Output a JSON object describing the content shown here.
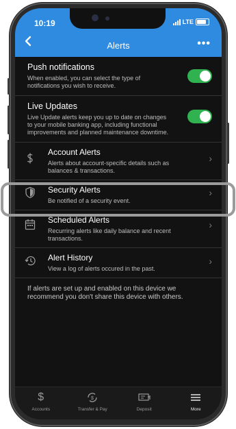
{
  "status": {
    "time": "10:19",
    "network": "LTE"
  },
  "nav": {
    "title": "Alerts",
    "back_icon": "chevron-left-icon",
    "more_label": "•••"
  },
  "toggles": [
    {
      "title": "Push notifications",
      "desc": "When enabled, you can select the type of notifications you wish to receive.",
      "on": true
    },
    {
      "title": "Live Updates",
      "desc": "Live Update alerts keep you up to date on changes to your mobile banking app, including functional improvements and planned maintenance downtime.",
      "on": true
    }
  ],
  "items": [
    {
      "title": "Account Alerts",
      "desc": "Alerts about account-specific details such as balances & transactions.",
      "icon": "dollar-icon"
    },
    {
      "title": "Security Alerts",
      "desc": "Be notified of a security event.",
      "icon": "shield-icon"
    },
    {
      "title": "Scheduled Alerts",
      "desc": "Recurring alerts like daily balance and recent transactions.",
      "icon": "calendar-icon"
    },
    {
      "title": "Alert History",
      "desc": "View a log of alerts occured in the past.",
      "icon": "history-icon"
    }
  ],
  "footer_note": "If alerts are set up and enabled on this device we recommend you don't share this device with others.",
  "tabs": [
    {
      "label": "Accounts",
      "icon": "dollar-icon"
    },
    {
      "label": "Transfer & Pay",
      "icon": "transfer-icon"
    },
    {
      "label": "Deposit",
      "icon": "deposit-icon"
    },
    {
      "label": "More",
      "icon": "menu-icon",
      "active": true
    }
  ],
  "colors": {
    "header": "#2e8be0",
    "toggle_on": "#2fb24f",
    "background": "#121212"
  }
}
